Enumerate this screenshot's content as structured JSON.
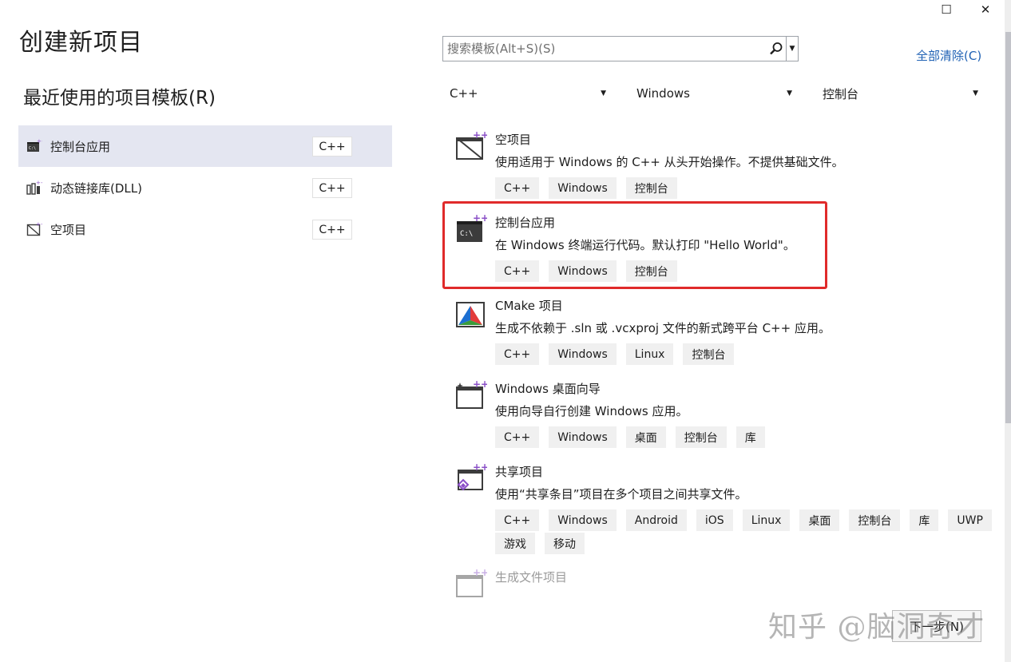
{
  "window": {
    "title": "创建新项目",
    "restore_glyph": "☐",
    "close_glyph": "✕"
  },
  "recent": {
    "heading": "最近使用的项目模板(R)",
    "items": [
      {
        "label": "控制台应用",
        "tag": "C++",
        "icon": "console-app-icon"
      },
      {
        "label": "动态链接库(DLL)",
        "tag": "C++",
        "icon": "dll-icon"
      },
      {
        "label": "空项目",
        "tag": "C++",
        "icon": "empty-project-icon"
      }
    ]
  },
  "search": {
    "placeholder": "搜索模板(Alt+S)(S)",
    "icon": "search-icon"
  },
  "clear_all": "全部清除(C)",
  "filters": {
    "language": "C++",
    "platform": "Windows",
    "project_type": "控制台"
  },
  "templates": [
    {
      "name": "空项目",
      "desc": "使用适用于 Windows 的 C++ 从头开始操作。不提供基础文件。",
      "tags": [
        "C++",
        "Windows",
        "控制台"
      ],
      "icon": "empty-project-icon"
    },
    {
      "name": "控制台应用",
      "desc": "在 Windows 终端运行代码。默认打印 \"Hello World\"。",
      "tags": [
        "C++",
        "Windows",
        "控制台"
      ],
      "icon": "console-app-icon"
    },
    {
      "name": "CMake 项目",
      "desc": "生成不依赖于 .sln 或 .vcxproj 文件的新式跨平台 C++ 应用。",
      "tags": [
        "C++",
        "Windows",
        "Linux",
        "控制台"
      ],
      "icon": "cmake-icon"
    },
    {
      "name": "Windows 桌面向导",
      "desc": "使用向导自行创建 Windows 应用。",
      "tags": [
        "C++",
        "Windows",
        "桌面",
        "控制台",
        "库"
      ],
      "icon": "desktop-wizard-icon"
    },
    {
      "name": "共享项目",
      "desc": "使用“共享条目”项目在多个项目之间共享文件。",
      "tags": [
        "C++",
        "Windows",
        "Android",
        "iOS",
        "Linux",
        "桌面",
        "控制台",
        "库",
        "UWP",
        "游戏",
        "移动"
      ],
      "icon": "shared-project-icon"
    },
    {
      "name": "生成文件项目",
      "desc": "",
      "tags": [],
      "icon": "makefile-project-icon"
    }
  ],
  "next_button": "下一步(N)",
  "watermark": "知乎 @脑洞奇才"
}
